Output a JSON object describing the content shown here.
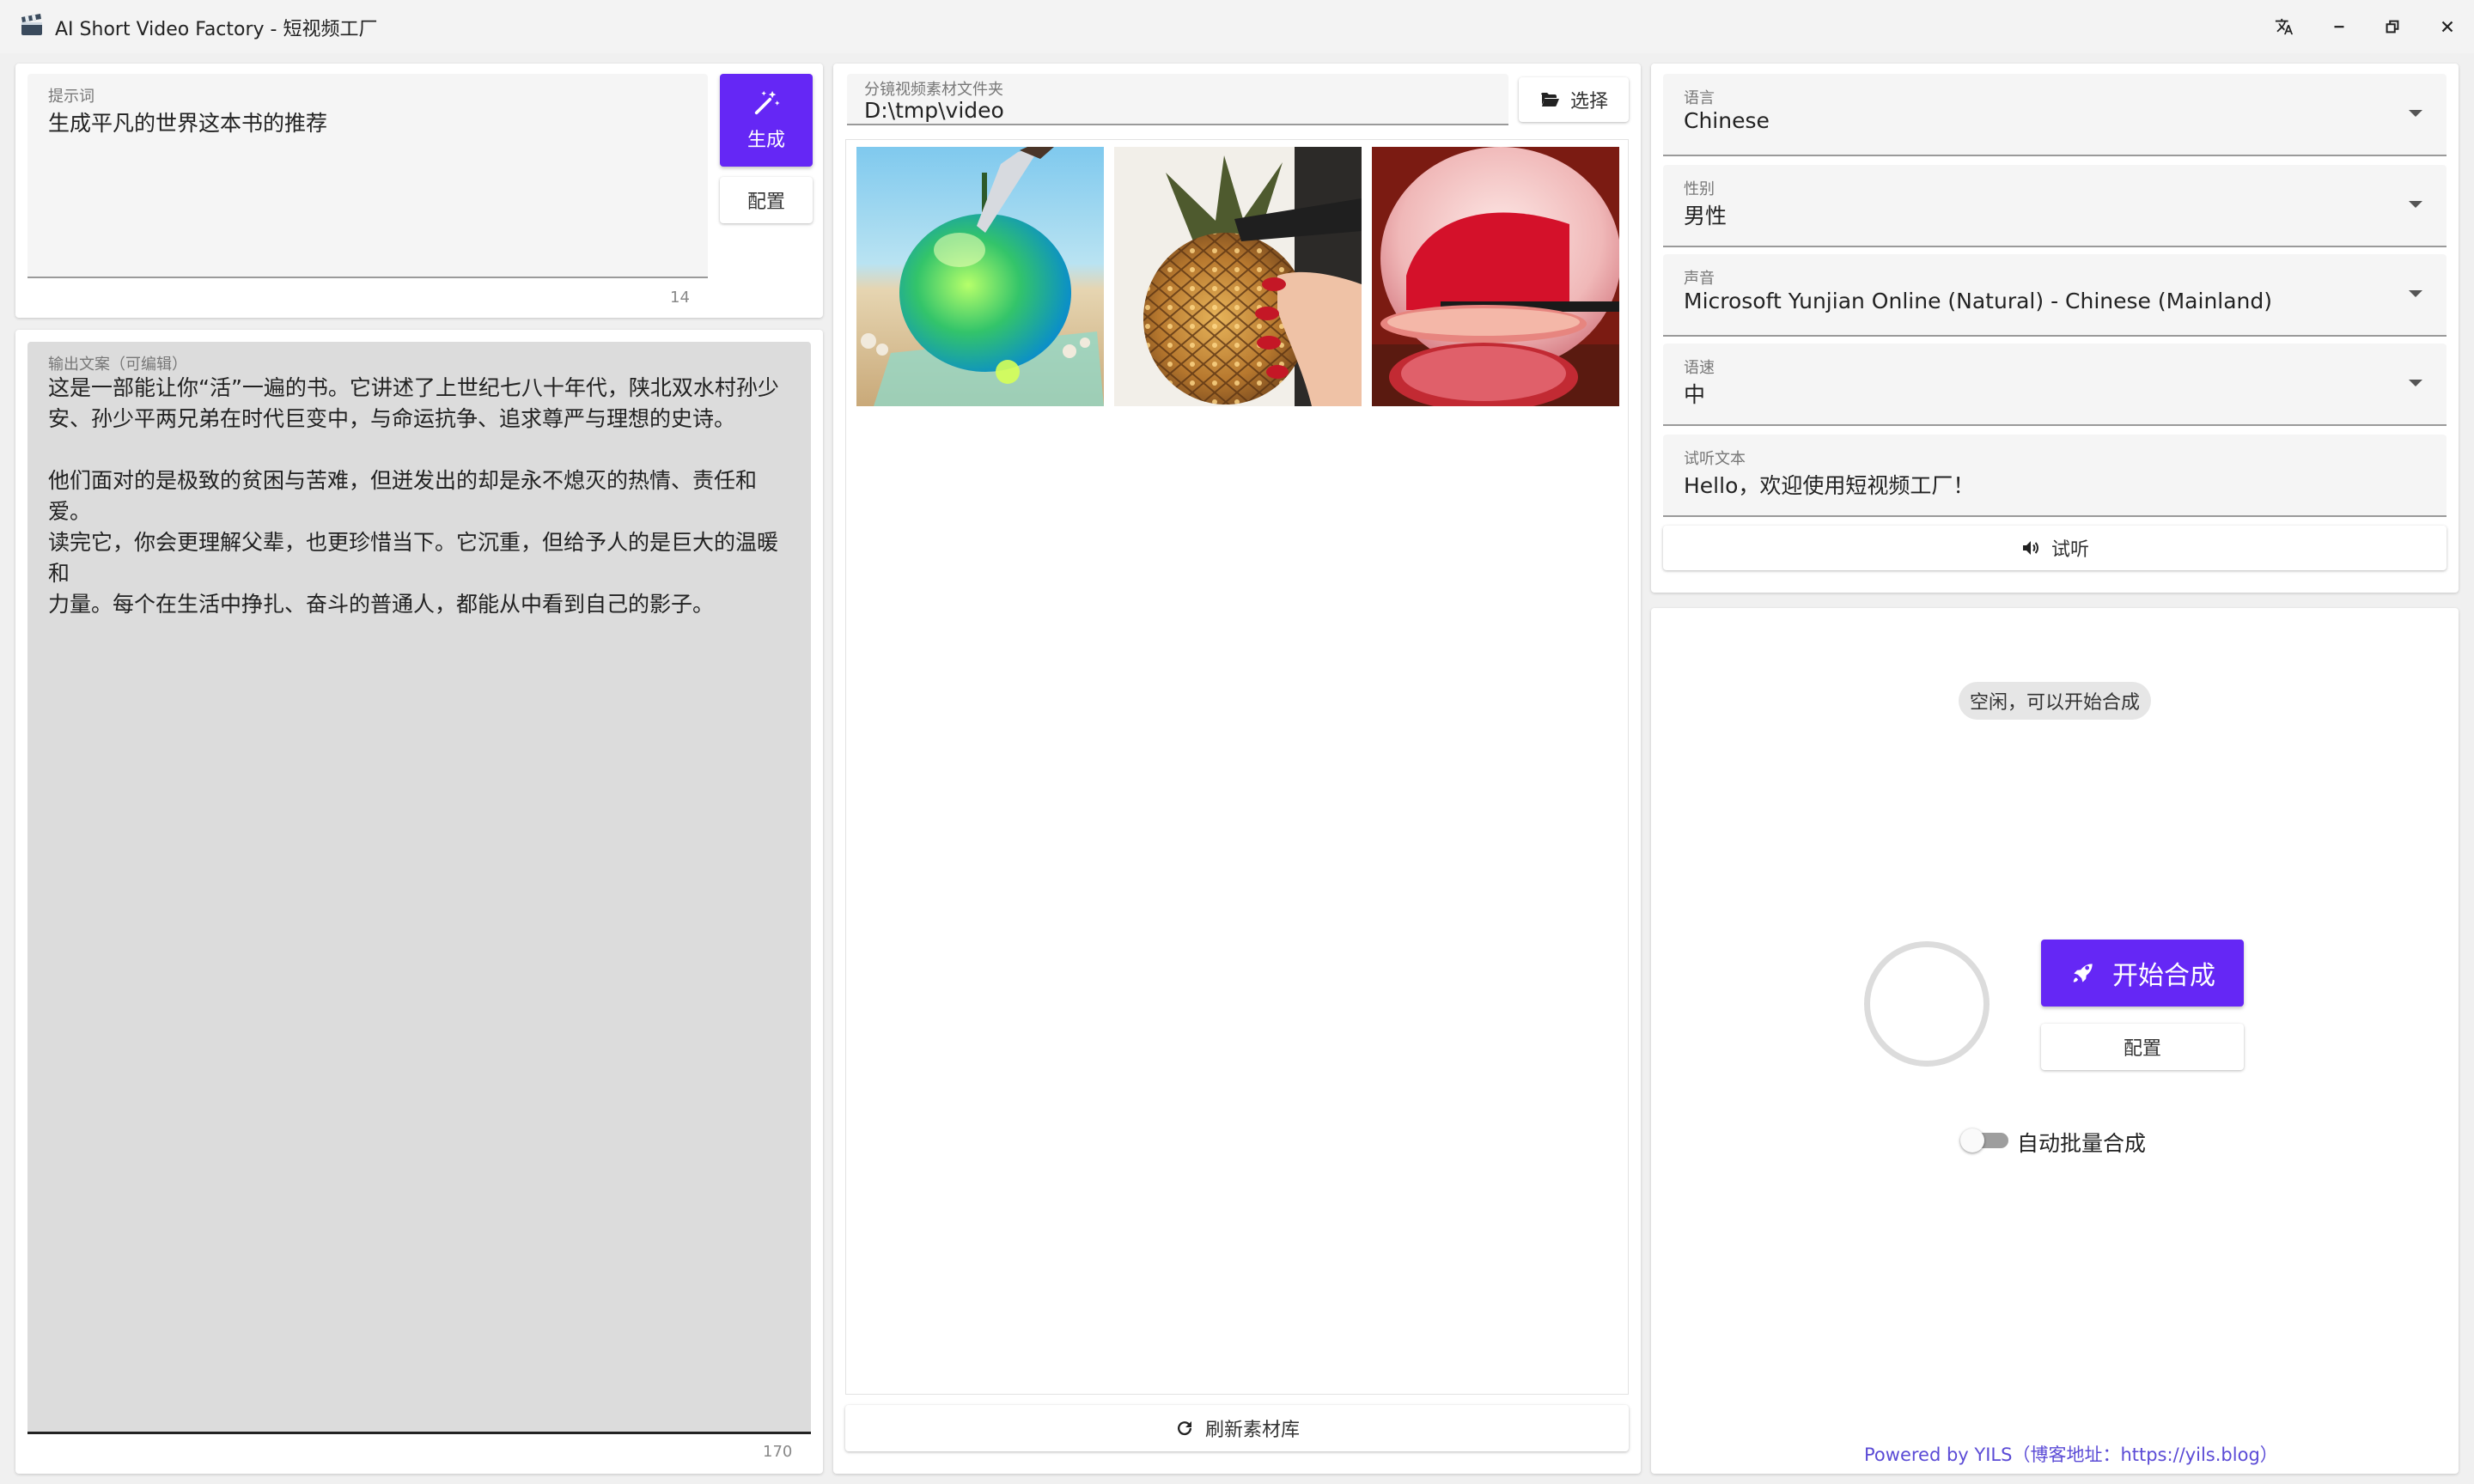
{
  "window": {
    "title": "AI Short Video Factory - 短视频工厂",
    "buttons": [
      "translate-icon",
      "minimize-icon",
      "restore-icon",
      "close-icon"
    ]
  },
  "prompt": {
    "label": "提示词",
    "value": "生成平凡的世界这本书的推荐",
    "count": "14",
    "generate_label": "生成",
    "config_label": "配置"
  },
  "output": {
    "label": "输出文案（可编辑）",
    "text": "这是一部能让你“活”一遍的书。它讲述了上世纪七八十年代，陕北双水村孙少\n安、孙少平两兄弟在时代巨变中，与命运抗争、追求尊严与理想的史诗。\n\n他们面对的是极致的贫困与苦难，但迸发出的却是永不熄灭的热情、责任和爱。\n读完它，你会更理解父辈，也更珍惜当下。它沉重，但给予人的是巨大的温暖和\n力量。每个在生活中挣扎、奋斗的普通人，都能从中看到自己的影子。",
    "count": "170"
  },
  "material": {
    "folder_label": "分镜视频素材文件夹",
    "folder_value": "D:\\tmp\\video",
    "select_label": "选择",
    "refresh_label": "刷新素材库",
    "thumbnails": [
      "glass-apple-knife",
      "glass-pineapple-knife",
      "red-fruit-slice"
    ]
  },
  "tts": {
    "language_label": "语言",
    "language_value": "Chinese",
    "gender_label": "性别",
    "gender_value": "男性",
    "voice_label": "声音",
    "voice_value": "Microsoft Yunjian Online (Natural) - Chinese (Mainland)",
    "speed_label": "语速",
    "speed_value": "中",
    "test_text_label": "试听文本",
    "test_text_value": "Hello，欢迎使用短视频工厂！",
    "listen_label": "试听"
  },
  "compose": {
    "status": "空闲，可以开始合成",
    "start_label": "开始合成",
    "config_label": "配置",
    "auto_batch_label": "自动批量合成",
    "auto_batch_on": false
  },
  "footer": {
    "text": "Powered by YILS（博客地址：https://yils.blog）"
  },
  "colors": {
    "accent": "#6527f5",
    "link": "#5b4bd6"
  }
}
